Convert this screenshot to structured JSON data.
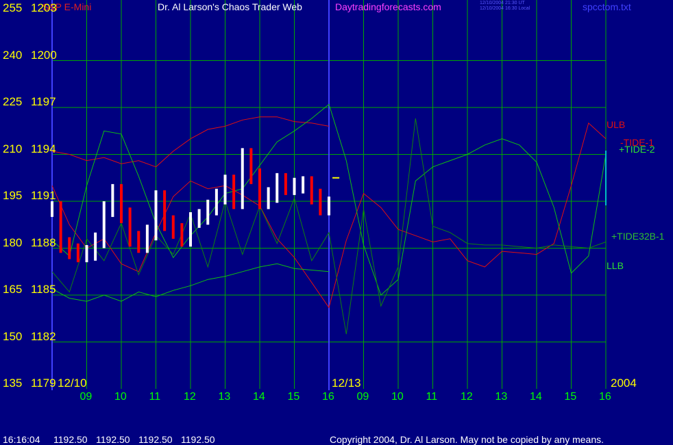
{
  "header": {
    "symbol": "S&P E-Mini",
    "title": "Dr. Al Larson's Chaos Trader Web",
    "site": "Daytradingforecasts.com",
    "time_utc": "12/10/2004 21:30 UT",
    "time_local": "12/10/2004 16:30 Local",
    "file": "spcctom.txt"
  },
  "y_axis_left": [
    "255",
    "240",
    "225",
    "210",
    "195",
    "180",
    "165",
    "150",
    "135"
  ],
  "y_axis_right": [
    "1203",
    "1200",
    "1197",
    "1194",
    "1191",
    "1188",
    "1185",
    "1182",
    "1179"
  ],
  "date_labels": {
    "start": "12/10",
    "mid": "12/13",
    "year": "2004"
  },
  "x_hours": [
    "09",
    "10",
    "11",
    "12",
    "13",
    "14",
    "15",
    "16",
    "09",
    "10",
    "11",
    "12",
    "13",
    "14",
    "15",
    "16"
  ],
  "legend": {
    "ulb": "ULB",
    "tide1": "-TIDE-1",
    "tide2": "+TIDE-2",
    "tide32": "+TIDE32B-1",
    "llb": "LLB"
  },
  "footer": {
    "time": "16:16:04",
    "open": "1192.50",
    "high": "1192.50",
    "low": "1192.50",
    "close": "1192.50",
    "copyright": "Copyright 2004, Dr. Al Larson. May not be copied by any means."
  },
  "colors": {
    "background": "#000080",
    "grid": "#00a800",
    "up_bars": "#ffffff",
    "down_bars": "#ff0000",
    "ulb": "#e01010",
    "tide2": "#10c010",
    "tide32": "#108010",
    "divider": "#4040ff",
    "last_price": "#ffff00"
  },
  "chart_data": {
    "type": "line",
    "price_axis_range": [
      1179,
      1203
    ],
    "oscillator_axis_range": [
      135,
      255
    ],
    "x_ticks": [
      "09",
      "10",
      "11",
      "12",
      "13",
      "14",
      "15",
      "16",
      "09",
      "10",
      "11",
      "12",
      "13",
      "14",
      "15",
      "16"
    ],
    "grid": true,
    "price_bars": {
      "x": [
        0,
        0.25,
        0.5,
        0.75,
        1,
        1.25,
        1.5,
        1.75,
        2,
        2.25,
        2.5,
        2.75,
        3,
        3.25,
        3.5,
        3.75,
        4,
        4.25,
        4.5,
        4.75,
        5,
        5.25,
        5.5,
        5.75,
        6,
        6.25,
        6.5,
        6.75,
        7,
        7.25,
        7.5,
        7.75,
        8
      ],
      "close": [
        1190.5,
        1188.2,
        1187.8,
        1187.6,
        1187.7,
        1188.5,
        1190.5,
        1191.6,
        1190.1,
        1188.6,
        1188.2,
        1189.0,
        1191.2,
        1189.6,
        1189.1,
        1188.6,
        1189.8,
        1190.0,
        1190.6,
        1191.3,
        1192.2,
        1191.0,
        1193.9,
        1192.6,
        1191.0,
        1191.4,
        1192.3,
        1191.9,
        1192.0,
        1192.1,
        1191.3,
        1190.6,
        1190.8
      ]
    },
    "last_price": {
      "value": 1192.5,
      "x": [
        8.1,
        8.3
      ]
    },
    "series": [
      {
        "name": "ULB",
        "x": [
          0,
          0.5,
          1,
          1.5,
          2,
          2.5,
          3,
          3.5,
          4,
          4.5,
          5,
          5.5,
          6,
          6.5,
          7,
          7.5,
          8,
          8.5,
          9,
          9.5,
          10,
          10.5,
          11,
          11.5,
          12,
          12.5,
          13,
          13.5,
          14,
          14.5,
          15,
          15.5,
          16
        ],
        "values": [
          1194.2,
          1194.0,
          1193.6,
          1193.8,
          1193.4,
          1193.6,
          1193.2,
          1194.2,
          1195.0,
          1195.6,
          1195.8,
          1196.2,
          1196.4,
          1196.4,
          1196.1,
          1196.0,
          1195.8,
          null,
          null,
          null,
          null,
          null,
          null,
          null,
          null,
          null,
          null,
          null,
          null,
          null,
          null,
          null,
          null
        ]
      },
      {
        "name": "-TIDE-1",
        "x": [
          0,
          0.5,
          1,
          1.5,
          2,
          2.5,
          3,
          3.5,
          4,
          4.5,
          5,
          5.5,
          6,
          6.5,
          7,
          7.5,
          8,
          8.5,
          9,
          9.5,
          10,
          10.5,
          11,
          11.5,
          12,
          12.5,
          13,
          13.5,
          14,
          14.5,
          15,
          15.5,
          16
        ],
        "values": [
          1192.0,
          1189.5,
          1188.0,
          1188.6,
          1187.0,
          1186.5,
          1189.0,
          1191.3,
          1192.3,
          1191.8,
          1192.0,
          1191.4,
          1190.7,
          1188.6,
          1187.4,
          1185.8,
          1184.2,
          1188.5,
          1191.5,
          1190.6,
          1189.2,
          1188.8,
          1188.4,
          1188.6,
          1187.2,
          1186.8,
          1187.8,
          1187.7,
          1187.6,
          1188.3,
          1192.0,
          1196.0,
          1195.0
        ]
      },
      {
        "name": "+TIDE-2",
        "x": [
          0,
          0.5,
          1,
          1.5,
          2,
          2.5,
          3,
          3.5,
          4,
          4.5,
          5,
          5.5,
          6,
          6.5,
          7,
          7.5,
          8,
          8.5,
          9,
          9.5,
          10,
          10.5,
          11,
          11.5,
          12,
          12.5,
          13,
          13.5,
          14,
          14.5,
          15,
          15.5,
          16
        ],
        "values": [
          1188.5,
          1187.5,
          1192.0,
          1195.5,
          1195.3,
          1192.6,
          1189.6,
          1187.4,
          1188.8,
          1190.0,
          1191.5,
          1191.8,
          1193.3,
          1194.8,
          1195.5,
          1196.3,
          1197.2,
          1193.6,
          1188.2,
          1185.0,
          1186.0,
          1192.3,
          1193.2,
          1193.6,
          1194.0,
          1194.6,
          1195.0,
          1194.6,
          1193.5,
          1190.6,
          1186.4,
          1187.5,
          1194.0
        ]
      },
      {
        "name": "LLB",
        "x": [
          0,
          0.5,
          1,
          1.5,
          2,
          2.5,
          3,
          3.5,
          4,
          4.5,
          5,
          5.5,
          6,
          6.5,
          7,
          7.5,
          8,
          8.5,
          9,
          9.5,
          10,
          10.5,
          11,
          11.5,
          12,
          12.5,
          13,
          13.5,
          14,
          14.5,
          15,
          15.5,
          16
        ],
        "values": [
          1185.4,
          1184.8,
          1184.6,
          1185.0,
          1184.6,
          1185.2,
          1184.9,
          1185.3,
          1185.6,
          1186.0,
          1186.2,
          1186.5,
          1186.8,
          1187.0,
          1186.7,
          1186.6,
          1186.5,
          null,
          null,
          null,
          null,
          null,
          null,
          null,
          null,
          null,
          null,
          null,
          null,
          null,
          null,
          null,
          null
        ]
      },
      {
        "name": "+TIDE32B-1",
        "x": [
          0,
          0.5,
          1,
          1.5,
          2,
          2.5,
          3,
          3.5,
          4,
          4.5,
          5,
          5.5,
          6,
          6.5,
          7,
          7.5,
          8,
          8.5,
          9,
          9.5,
          10,
          10.5,
          11,
          11.5,
          12,
          12.5,
          13,
          13.5,
          14,
          14.5,
          15,
          15.5,
          16
        ],
        "values": [
          1186.5,
          1185.2,
          1188.6,
          1187.2,
          1189.6,
          1186.3,
          1188.8,
          1187.6,
          1190.2,
          1186.8,
          1191.0,
          1187.6,
          1190.7,
          1188.3,
          1191.2,
          1187.2,
          1189.0,
          1182.5,
          1190.5,
          1184.3,
          1186.8,
          1196.3,
          1189.4,
          1189.0,
          1188.3,
          1188.2,
          1188.2,
          1188.1,
          1188.0,
          1188.2,
          1188.1,
          1188.0,
          1188.4
        ]
      }
    ]
  }
}
